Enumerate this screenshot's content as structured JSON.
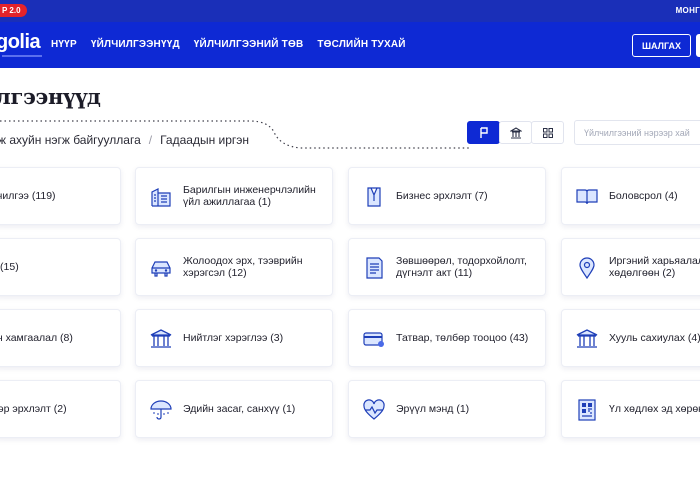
{
  "topbar": {
    "badge": "P 2.0",
    "lang": "МОНГ"
  },
  "navbar": {
    "logo": "golia",
    "items": [
      "НҮҮР",
      "ҮЙЛЧИЛГЭЭНҮҮД",
      "ҮЙЛЧИЛГЭЭНИЙ ТӨВ",
      "ТӨСЛИЙН ТУХАЙ"
    ],
    "search_button": "ШАЛГАХ"
  },
  "page": {
    "title": "лгээнүүд"
  },
  "breadcrumb": {
    "first": "ж ахуйн нэгж байгууллага",
    "separator": "/",
    "second": "Гадаадын иргэн"
  },
  "search": {
    "placeholder": "Үйлчилгээний нэрээр хай"
  },
  "accent_color": "#0e29d4",
  "cards": [
    {
      "label": "лчилгээ (119)",
      "icon": ""
    },
    {
      "label": "Барилгын инженерчлэлийн\nүйл ажиллагаа (1)",
      "icon": "building-icon"
    },
    {
      "label": "Бизнес эрхлэлт (7)",
      "icon": "suit-icon"
    },
    {
      "label": "Боловсрол (4)",
      "icon": "book-icon"
    },
    {
      "label": "л (15)",
      "icon": ""
    },
    {
      "label": "Жолоодох эрх, тээврийн\nхэрэгсэл (12)",
      "icon": "car-icon"
    },
    {
      "label": "Зөвшөөрөл, тодорхойлолт,\nдүгнэлт акт (11)",
      "icon": "document-icon"
    },
    {
      "label": "Иргэний харьяалал\nхөдөлгөөн (2)",
      "icon": "location-pin-icon"
    },
    {
      "label": "йн хамгаалал (8)",
      "icon": ""
    },
    {
      "label": "Нийтлэг хэрэглээ (3)",
      "icon": "public-building-icon"
    },
    {
      "label": "Татвар, төлбөр тооцоо (43)",
      "icon": "credit-card-icon"
    },
    {
      "label": "Хууль сахиулах (4)",
      "icon": "law-building-icon"
    },
    {
      "label": "мэр эрхлэлт (2)",
      "icon": ""
    },
    {
      "label": "Эдийн засаг, санхүү (1)",
      "icon": "umbrella-icon"
    },
    {
      "label": "Эрүүл мэнд (1)",
      "icon": "heart-pulse-icon"
    },
    {
      "label": "Үл хөдлөх эд хөрөн",
      "icon": "qr-document-icon"
    }
  ]
}
